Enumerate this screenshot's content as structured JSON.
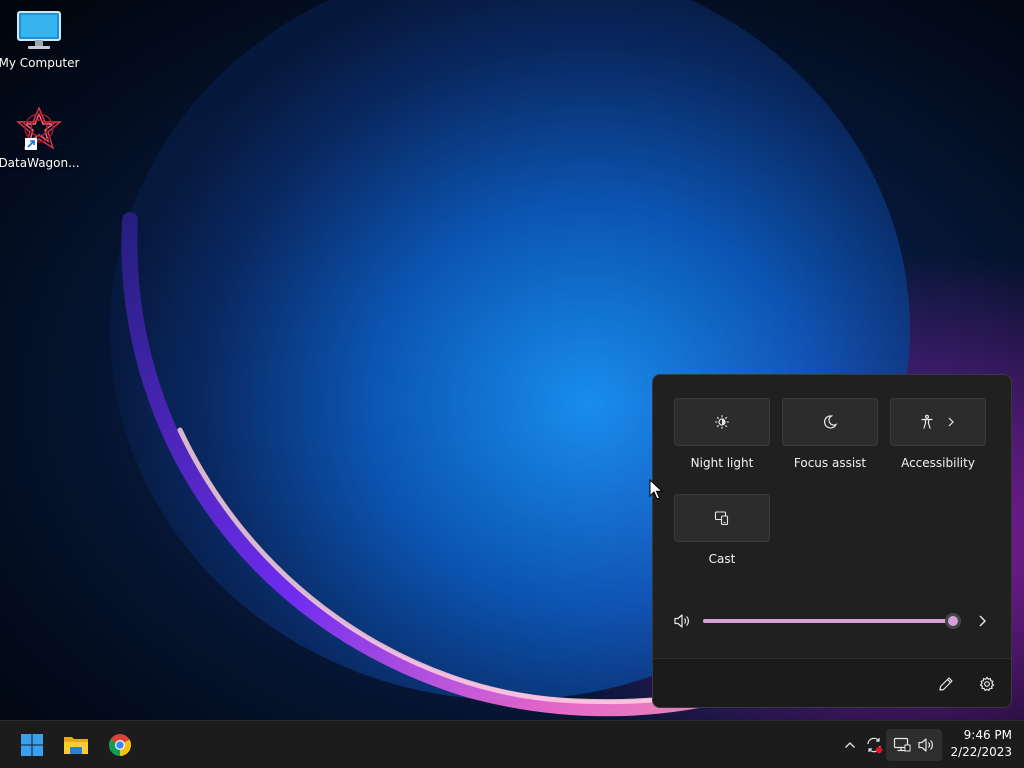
{
  "desktop": {
    "icons": [
      {
        "label": "My Computer",
        "icon": "monitor-icon"
      },
      {
        "label": "DataWagon...",
        "icon": "datawagon-app-icon"
      }
    ]
  },
  "quick_settings": {
    "tiles": [
      {
        "label": "Night light",
        "icon": "night-light-icon"
      },
      {
        "label": "Focus assist",
        "icon": "moon-icon"
      },
      {
        "label": "Accessibility",
        "icon": "accessibility-icon",
        "has_chevron": true
      },
      {
        "label": "Cast",
        "icon": "cast-icon"
      }
    ],
    "volume": {
      "level_percent": 100,
      "icon": "speaker-icon",
      "accent": "#d6a1d8"
    },
    "footer": {
      "edit_icon": "pencil-icon",
      "settings_icon": "gear-icon"
    }
  },
  "taskbar": {
    "pinned": [
      {
        "name": "Start",
        "icon": "windows-logo-icon"
      },
      {
        "name": "File Explorer",
        "icon": "folder-icon"
      },
      {
        "name": "Google Chrome",
        "icon": "chrome-icon"
      }
    ],
    "tray": {
      "overflow_icon": "chevron-up-icon",
      "sync_icon": "sync-icon",
      "network_icon": "network-icon",
      "volume_icon": "speaker-icon"
    },
    "clock": {
      "time": "9:46 PM",
      "date": "2/22/2023"
    }
  }
}
